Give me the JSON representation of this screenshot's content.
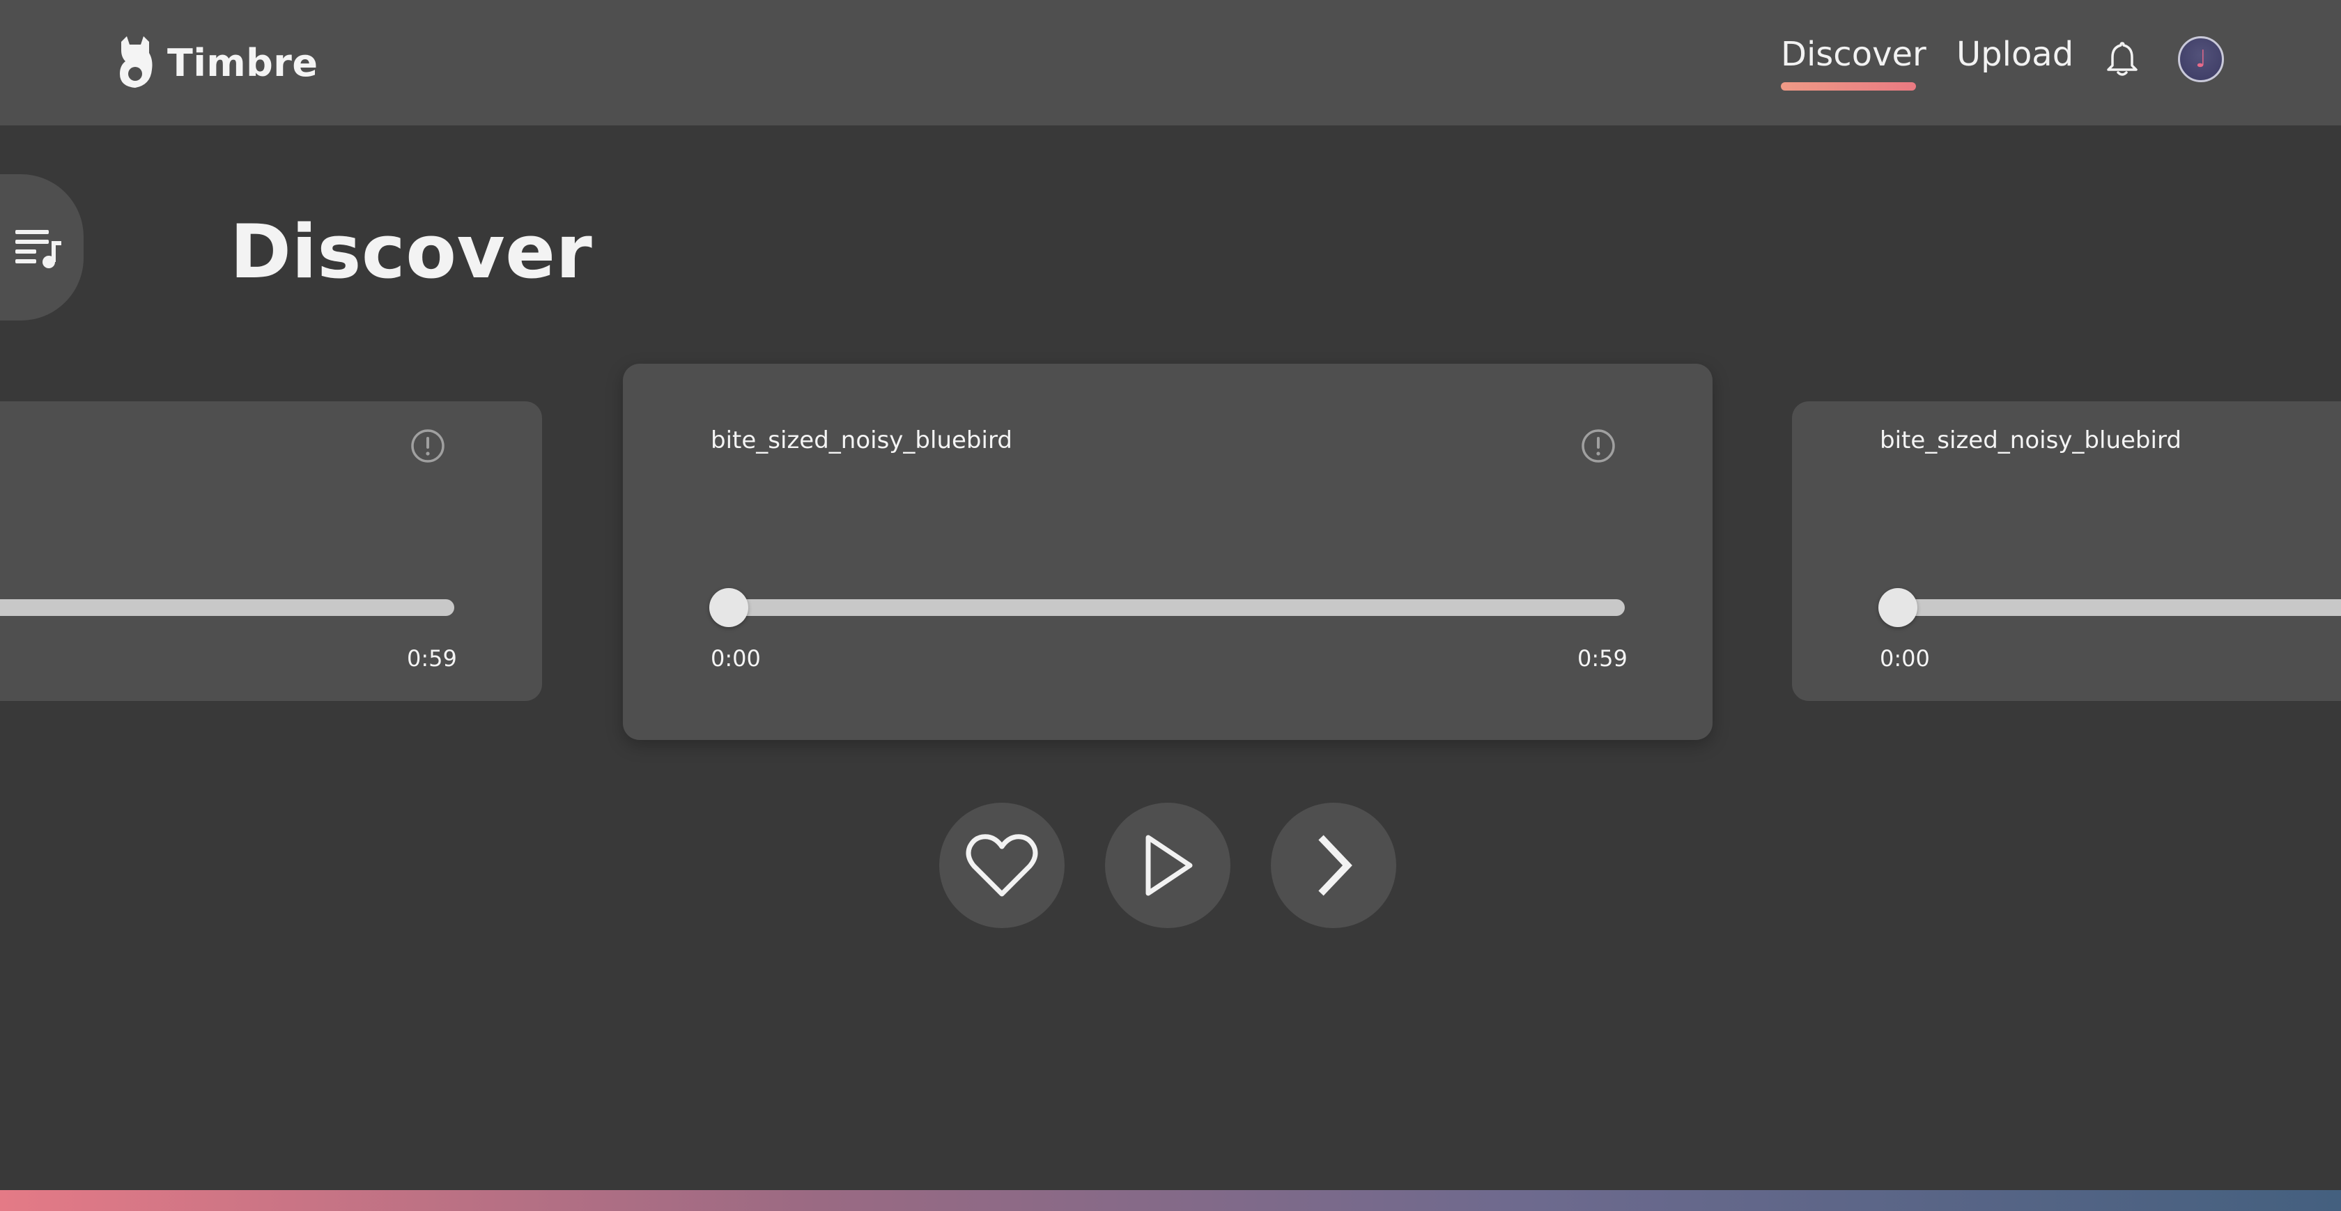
{
  "header": {
    "brand_name": "Timbre",
    "brand_icon": "cat-logo-icon",
    "nav": [
      {
        "label": "Discover",
        "active": true
      },
      {
        "label": "Upload",
        "active": false
      }
    ],
    "notifications_icon": "bell-icon",
    "avatar_icon": "music-note-icon"
  },
  "sidebar": {
    "queue_icon": "queue-music-icon"
  },
  "page": {
    "title": "Discover"
  },
  "cards": {
    "previous": {
      "title": "",
      "current_time": "",
      "duration": "0:59",
      "progress": 0
    },
    "current": {
      "title": "bite_sized_noisy_bluebird",
      "current_time": "0:00",
      "duration": "0:59",
      "progress": 0
    },
    "next": {
      "title": "bite_sized_noisy_bluebird",
      "current_time": "0:00",
      "duration": "",
      "progress": 0
    }
  },
  "controls": {
    "like_icon": "heart-icon",
    "play_icon": "play-icon",
    "next_icon": "chevron-right-icon"
  },
  "colors": {
    "background": "#393939",
    "surface": "#4f4f4f",
    "accent": "#e97a82",
    "slider": "#c8c8c8"
  }
}
